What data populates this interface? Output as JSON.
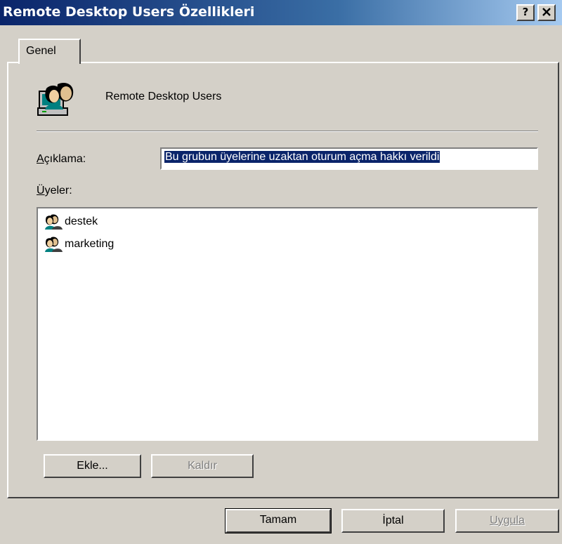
{
  "window": {
    "title": "Remote Desktop Users Özellikleri",
    "help_button": "?",
    "close_button": "✕"
  },
  "tabs": [
    {
      "label": "Genel",
      "active": true
    }
  ],
  "group": {
    "name": "Remote Desktop Users",
    "icon": "user-group-icon"
  },
  "description": {
    "label": "Açıklama:",
    "value": "Bu grubun üyelerine uzaktan oturum açma hakkı verildi"
  },
  "members": {
    "label": "Üyeler:",
    "items": [
      {
        "name": "destek",
        "icon": "user-group-icon"
      },
      {
        "name": "marketing",
        "icon": "user-group-icon"
      }
    ]
  },
  "member_buttons": {
    "add": "Ekle...",
    "remove": "Kaldır",
    "remove_enabled": false
  },
  "dialog_buttons": {
    "ok": "Tamam",
    "cancel": "İptal",
    "apply": "Uygula",
    "apply_enabled": false
  },
  "colors": {
    "titlebar_start": "#0a246a",
    "titlebar_end": "#a6caf0",
    "face": "#d4d0c8",
    "selection": "#0a246a"
  }
}
